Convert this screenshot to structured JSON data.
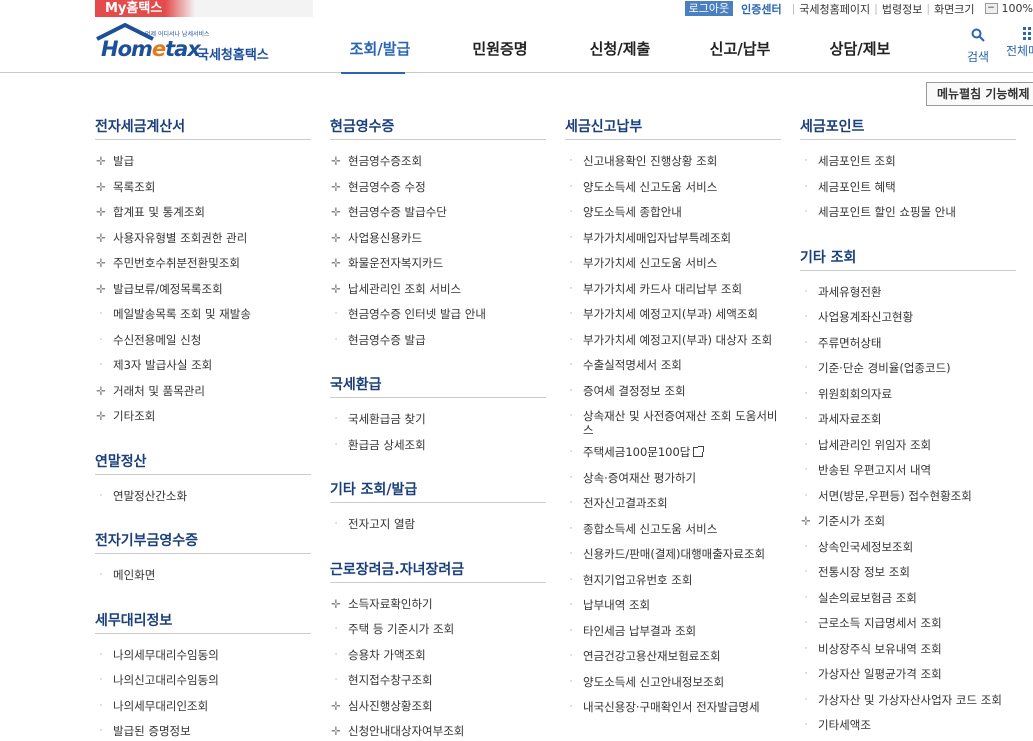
{
  "topbar": {
    "my_hometax": "My홈택스",
    "logout": "로그아웃",
    "cert_center": "인증센터",
    "links": [
      "국세청홈페이지",
      "법령정보",
      "화면크기"
    ],
    "zoom_minus": "−",
    "zoom_value": "100%"
  },
  "header": {
    "logo_small": "언제 어디서나 납세서비스",
    "logo_brand_a": "Hom",
    "logo_brand_e": "e",
    "logo_brand_b": "tax",
    "logo_korean": "국세청홈택스",
    "nav": [
      "조회/발급",
      "민원증명",
      "신청/제출",
      "신고/납부",
      "상담/제보"
    ],
    "search_label": "검색",
    "all_label": "전체메뉴"
  },
  "fold_button": "메뉴펼침 기능해제",
  "columns": [
    {
      "sections": [
        {
          "title": "전자세금계산서",
          "items": [
            {
              "label": "발급",
              "marker": "plus"
            },
            {
              "label": "목록조회",
              "marker": "plus"
            },
            {
              "label": "합계표 및 통계조회",
              "marker": "plus"
            },
            {
              "label": "사용자유형별 조회권한 관리",
              "marker": "plus"
            },
            {
              "label": "주민번호수취분전환및조회",
              "marker": "plus"
            },
            {
              "label": "발급보류/예정목록조회",
              "marker": "plus"
            },
            {
              "label": "메일발송목록 조회 및 재발송",
              "marker": "dot"
            },
            {
              "label": "수신전용메일 신청",
              "marker": "dot"
            },
            {
              "label": "제3자 발급사실 조회",
              "marker": "dot"
            },
            {
              "label": "거래처 및 품목관리",
              "marker": "plus"
            },
            {
              "label": "기타조회",
              "marker": "plus"
            }
          ]
        },
        {
          "title": "연말정산",
          "items": [
            {
              "label": "연말정산간소화",
              "marker": "dot"
            }
          ]
        },
        {
          "title": "전자기부금영수증",
          "items": [
            {
              "label": "메인화면",
              "marker": "dot"
            }
          ]
        },
        {
          "title": "세무대리정보",
          "items": [
            {
              "label": "나의세무대리수임동의",
              "marker": "dot"
            },
            {
              "label": "나의신고대리수임동의",
              "marker": "dot"
            },
            {
              "label": "나의세무대리인조회",
              "marker": "dot"
            },
            {
              "label": "발급된 증명정보",
              "marker": "dot"
            }
          ]
        }
      ]
    },
    {
      "sections": [
        {
          "title": "현금영수증",
          "items": [
            {
              "label": "현금영수증조회",
              "marker": "plus"
            },
            {
              "label": "현금영수증 수정",
              "marker": "plus"
            },
            {
              "label": "현금영수증 발급수단",
              "marker": "plus"
            },
            {
              "label": "사업용신용카드",
              "marker": "plus"
            },
            {
              "label": "화물운전자복지카드",
              "marker": "plus"
            },
            {
              "label": "납세관리인 조회 서비스",
              "marker": "plus"
            },
            {
              "label": "현금영수증 인터넷 발급 안내",
              "marker": "dot"
            },
            {
              "label": "현금영수증 발급",
              "marker": "dot"
            }
          ]
        },
        {
          "title": "국세환급",
          "items": [
            {
              "label": "국세환급금 찾기",
              "marker": "dot"
            },
            {
              "label": "환급금 상세조회",
              "marker": "dot"
            }
          ]
        },
        {
          "title": "기타 조회/발급",
          "items": [
            {
              "label": "전자고지 열람",
              "marker": "dot"
            }
          ]
        },
        {
          "title": "근로장려금.자녀장려금",
          "items": [
            {
              "label": "소득자료확인하기",
              "marker": "plus"
            },
            {
              "label": "주택 등 기준시가 조회",
              "marker": "dot"
            },
            {
              "label": "승용차 가액조회",
              "marker": "dot"
            },
            {
              "label": "현지접수창구조회",
              "marker": "dot"
            },
            {
              "label": "심사진행상황조회",
              "marker": "plus"
            },
            {
              "label": "신청안내대상자여부조회",
              "marker": "plus"
            }
          ]
        }
      ]
    },
    {
      "sections": [
        {
          "title": "세금신고납부",
          "items": [
            {
              "label": "신고내용확인 진행상황 조회",
              "marker": "dot"
            },
            {
              "label": "양도소득세 신고도움 서비스",
              "marker": "dot"
            },
            {
              "label": "양도소득세 종합안내",
              "marker": "dot"
            },
            {
              "label": "부가가치세매입자납부특례조회",
              "marker": "dot"
            },
            {
              "label": "부가가치세 신고도움 서비스",
              "marker": "dot"
            },
            {
              "label": "부가가치세 카드사 대리납부 조회",
              "marker": "dot"
            },
            {
              "label": "부가가치세 예정고지(부과) 세액조회",
              "marker": "dot"
            },
            {
              "label": "부가가치세 예정고지(부과) 대상자 조회",
              "marker": "dot",
              "wrap": true
            },
            {
              "label": "수출실적명세서 조회",
              "marker": "dot"
            },
            {
              "label": "증여세 결정정보 조회",
              "marker": "dot"
            },
            {
              "label": "상속재산 및 사전증여재산 조회 도움서비스",
              "marker": "dot",
              "wrap": true
            },
            {
              "label": "주택세금100문100답",
              "marker": "dot",
              "external": true
            },
            {
              "label": "상속·증여재산 평가하기",
              "marker": "dot"
            },
            {
              "label": "전자신고결과조회",
              "marker": "dot"
            },
            {
              "label": "종합소득세 신고도움 서비스",
              "marker": "dot"
            },
            {
              "label": "신용카드/판매(결제)대행매출자료조회",
              "marker": "dot"
            },
            {
              "label": "현지기업고유번호 조회",
              "marker": "dot"
            },
            {
              "label": "납부내역 조회",
              "marker": "dot"
            },
            {
              "label": "타인세금 납부결과 조회",
              "marker": "dot"
            },
            {
              "label": "연금건강고용산재보험료조회",
              "marker": "dot"
            },
            {
              "label": "양도소득세 신고안내정보조회",
              "marker": "dot"
            },
            {
              "label": "내국신용장·구매확인서 전자발급명세",
              "marker": "dot"
            }
          ]
        }
      ]
    },
    {
      "sections": [
        {
          "title": "세금포인트",
          "items": [
            {
              "label": "세금포인트 조회",
              "marker": "dot"
            },
            {
              "label": "세금포인트 혜택",
              "marker": "dot"
            },
            {
              "label": "세금포인트 할인 쇼핑몰 안내",
              "marker": "dot"
            }
          ]
        },
        {
          "title": "기타 조회",
          "items": [
            {
              "label": "과세유형전환",
              "marker": "dot"
            },
            {
              "label": "사업용계좌신고현황",
              "marker": "dot"
            },
            {
              "label": "주류면허상태",
              "marker": "dot"
            },
            {
              "label": "기준·단순 경비율(업종코드)",
              "marker": "dot"
            },
            {
              "label": "위원회회의자료",
              "marker": "dot"
            },
            {
              "label": "과세자료조회",
              "marker": "dot"
            },
            {
              "label": "납세관리인 위임자 조회",
              "marker": "dot"
            },
            {
              "label": "반송된 우편고지서 내역",
              "marker": "dot"
            },
            {
              "label": "서면(방문,우편등) 접수현황조회",
              "marker": "dot"
            },
            {
              "label": "기준시가 조회",
              "marker": "plus"
            },
            {
              "label": "상속인국세정보조회",
              "marker": "dot"
            },
            {
              "label": "전통시장 정보 조회",
              "marker": "dot"
            },
            {
              "label": "실손의료보험금 조회",
              "marker": "dot"
            },
            {
              "label": "근로소득 지급명세서 조회",
              "marker": "dot"
            },
            {
              "label": "비상장주식 보유내역 조회",
              "marker": "dot"
            },
            {
              "label": "가상자산 일평균가격 조회",
              "marker": "dot"
            },
            {
              "label": "가상자산 및 가상자산사업자 코드 조회",
              "marker": "dot",
              "wrap": true
            },
            {
              "label": "기타세액조",
              "marker": "dot"
            }
          ]
        }
      ]
    }
  ],
  "colors": {
    "accent": "#2a66b3",
    "section_title": "#1a3f7a",
    "my_tab": "#e44b4b",
    "logo_orange": "#e37b19"
  }
}
